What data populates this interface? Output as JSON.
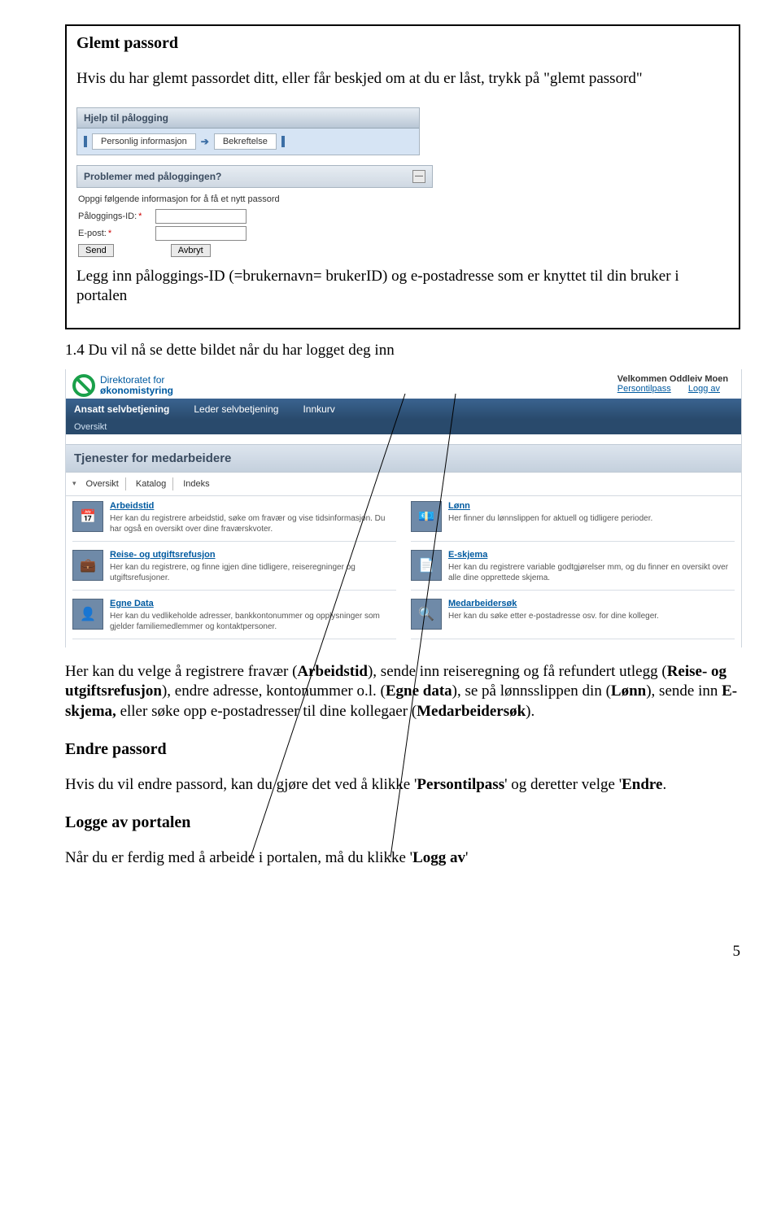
{
  "box": {
    "heading": "Glemt passord",
    "para1": "Hvis du har glemt passordet ditt, eller får beskjed om at du er låst, trykk på \"glemt passord\"",
    "hjelp_title": "Hjelp til pålogging",
    "crumb1": "Personlig informasjon",
    "crumb2": "Bekreftelse",
    "problemer_title": "Problemer med påloggingen?",
    "form_caption": "Oppgi følgende informasjon for å få et nytt passord",
    "field1_label": "Påloggings-ID:",
    "field2_label": "E-post:",
    "btn_send": "Send",
    "btn_cancel": "Avbryt",
    "para2": "Legg inn påloggings-ID (=brukernavn= brukerID) og e-postadresse som er knyttet til din bruker i portalen"
  },
  "section": {
    "heading14": "1.4 Du vil nå se dette bildet når du har logget deg inn",
    "app": {
      "logo_line1": "Direktoratet for",
      "logo_line2": "økonomistyring",
      "welcome": "Velkommen Oddleiv Moen",
      "link_pers": "Persontilpass",
      "link_logoff": "Logg av",
      "nav": [
        "Ansatt selvbetjening",
        "Leder selvbetjening",
        "Innkurv"
      ],
      "subnav": "Oversikt",
      "svc_title": "Tjenester for medarbeidere",
      "toolbar": [
        "Oversikt",
        "Katalog",
        "Indeks"
      ],
      "cells": [
        {
          "title": "Arbeidstid",
          "desc": "Her kan du registrere arbeidstid, søke om fravær og vise tidsinformasjon. Du har også en oversikt over dine fraværskvoter."
        },
        {
          "title": "Lønn",
          "desc": "Her finner du lønnslippen for aktuell og tidligere perioder."
        },
        {
          "title": "Reise- og utgiftsrefusjon",
          "desc": "Her kan du registrere, og finne igjen dine tidligere, reiseregninger og utgiftsrefusjoner."
        },
        {
          "title": "E-skjema",
          "desc": "Her kan du registrere variable godtgjørelser mm, og du finner en oversikt over alle dine opprettede skjema."
        },
        {
          "title": "Egne Data",
          "desc": "Her kan du vedlikeholde adresser, bankkontonummer og opplysninger som gjelder familiemedlemmer og kontaktpersoner."
        },
        {
          "title": "Medarbeidersøk",
          "desc": "Her kan du søke etter e-postadresse osv. for dine kolleger."
        }
      ]
    },
    "para_services_1a": "Her kan du velge å registrere fravær (",
    "para_services_arbeidstid": "Arbeidstid",
    "para_services_1b": "), sende inn reiseregning og få refundert utlegg (",
    "para_services_reise": "Reise- og utgiftsrefusjon",
    "para_services_1c": "), endre adresse, kontonummer o.l. (",
    "para_services_egne": "Egne data",
    "para_services_1d": "), se på lønnsslippen din (",
    "para_services_lonn": "Lønn",
    "para_services_1e": "), sende inn ",
    "para_services_eskjema": "E-skjema,",
    "para_services_1f": " eller søke opp e-postadresser til dine kollegaer (",
    "para_services_medarb": "Medarbeidersøk",
    "para_services_1g": ").",
    "endre_heading": "Endre passord",
    "endre_para_a": "Hvis du vil endre passord, kan du gjøre det ved å klikke '",
    "endre_para_b": "Persontilpass",
    "endre_para_c": "' og deretter velge '",
    "endre_para_d": "Endre",
    "endre_para_e": ".",
    "logav_heading": "Logge av portalen",
    "logav_para_a": "Når du er ferdig med å arbeide i portalen, må du klikke '",
    "logav_para_b": "Logg av",
    "logav_para_c": "'"
  },
  "page_number": "5"
}
